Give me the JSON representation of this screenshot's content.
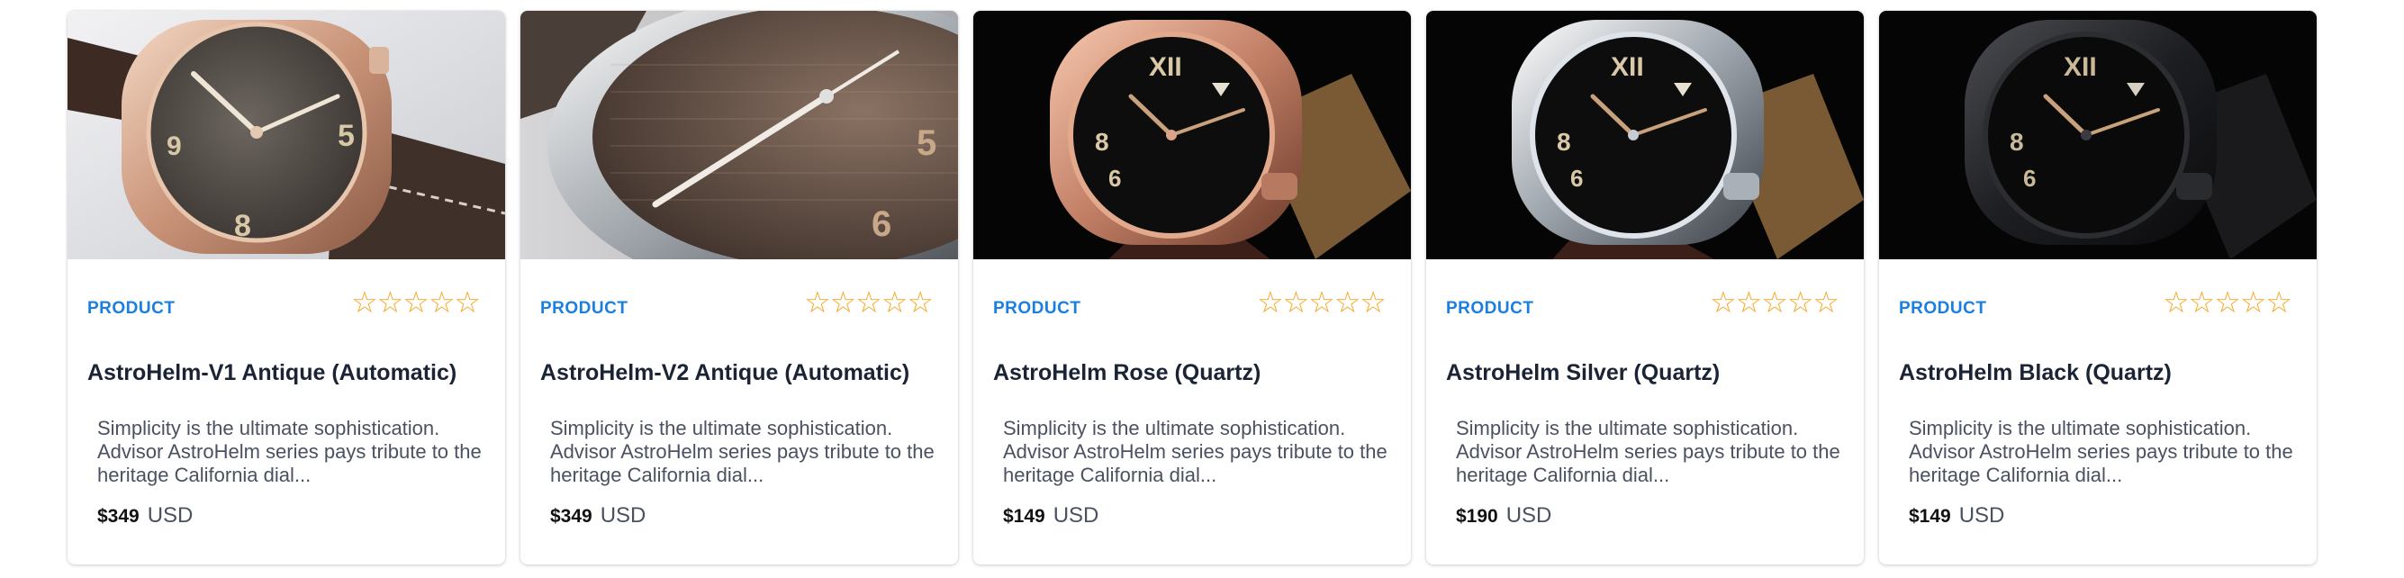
{
  "products": [
    {
      "tag": "PRODUCT",
      "stars": "☆☆☆☆☆",
      "title": "AstroHelm-V1 Antique (Automatic)",
      "desc": "Simplicity is the ultimate sophistication. Advisor AstroHelm series pays tribute to the heritage California dial...",
      "price": "$349",
      "currency": "USD",
      "image": "watch-antique-rose-gold"
    },
    {
      "tag": "PRODUCT",
      "stars": "☆☆☆☆☆",
      "title": "AstroHelm-V2 Antique (Automatic)",
      "desc": "Simplicity is the ultimate sophistication. Advisor AstroHelm series pays tribute to the heritage California dial...",
      "price": "$349",
      "currency": "USD",
      "image": "watch-antique-steel"
    },
    {
      "tag": "PRODUCT",
      "stars": "☆☆☆☆☆",
      "title": "AstroHelm Rose (Quartz)",
      "desc": "Simplicity is the ultimate sophistication. Advisor AstroHelm series pays tribute to the heritage California dial...",
      "price": "$149",
      "currency": "USD",
      "image": "watch-rose"
    },
    {
      "tag": "PRODUCT",
      "stars": "☆☆☆☆☆",
      "title": "AstroHelm Silver (Quartz)",
      "desc": "Simplicity is the ultimate sophistication. Advisor AstroHelm series pays tribute to the heritage California dial...",
      "price": "$190",
      "currency": "USD",
      "image": "watch-silver"
    },
    {
      "tag": "PRODUCT",
      "stars": "☆☆☆☆☆",
      "title": "AstroHelm Black (Quartz)",
      "desc": "Simplicity is the ultimate sophistication. Advisor AstroHelm series pays tribute to the heritage California dial...",
      "price": "$149",
      "currency": "USD",
      "image": "watch-black"
    }
  ],
  "colors": {
    "tag": "#1a7fe0",
    "star": "#f5a623",
    "title": "#1b2434"
  }
}
